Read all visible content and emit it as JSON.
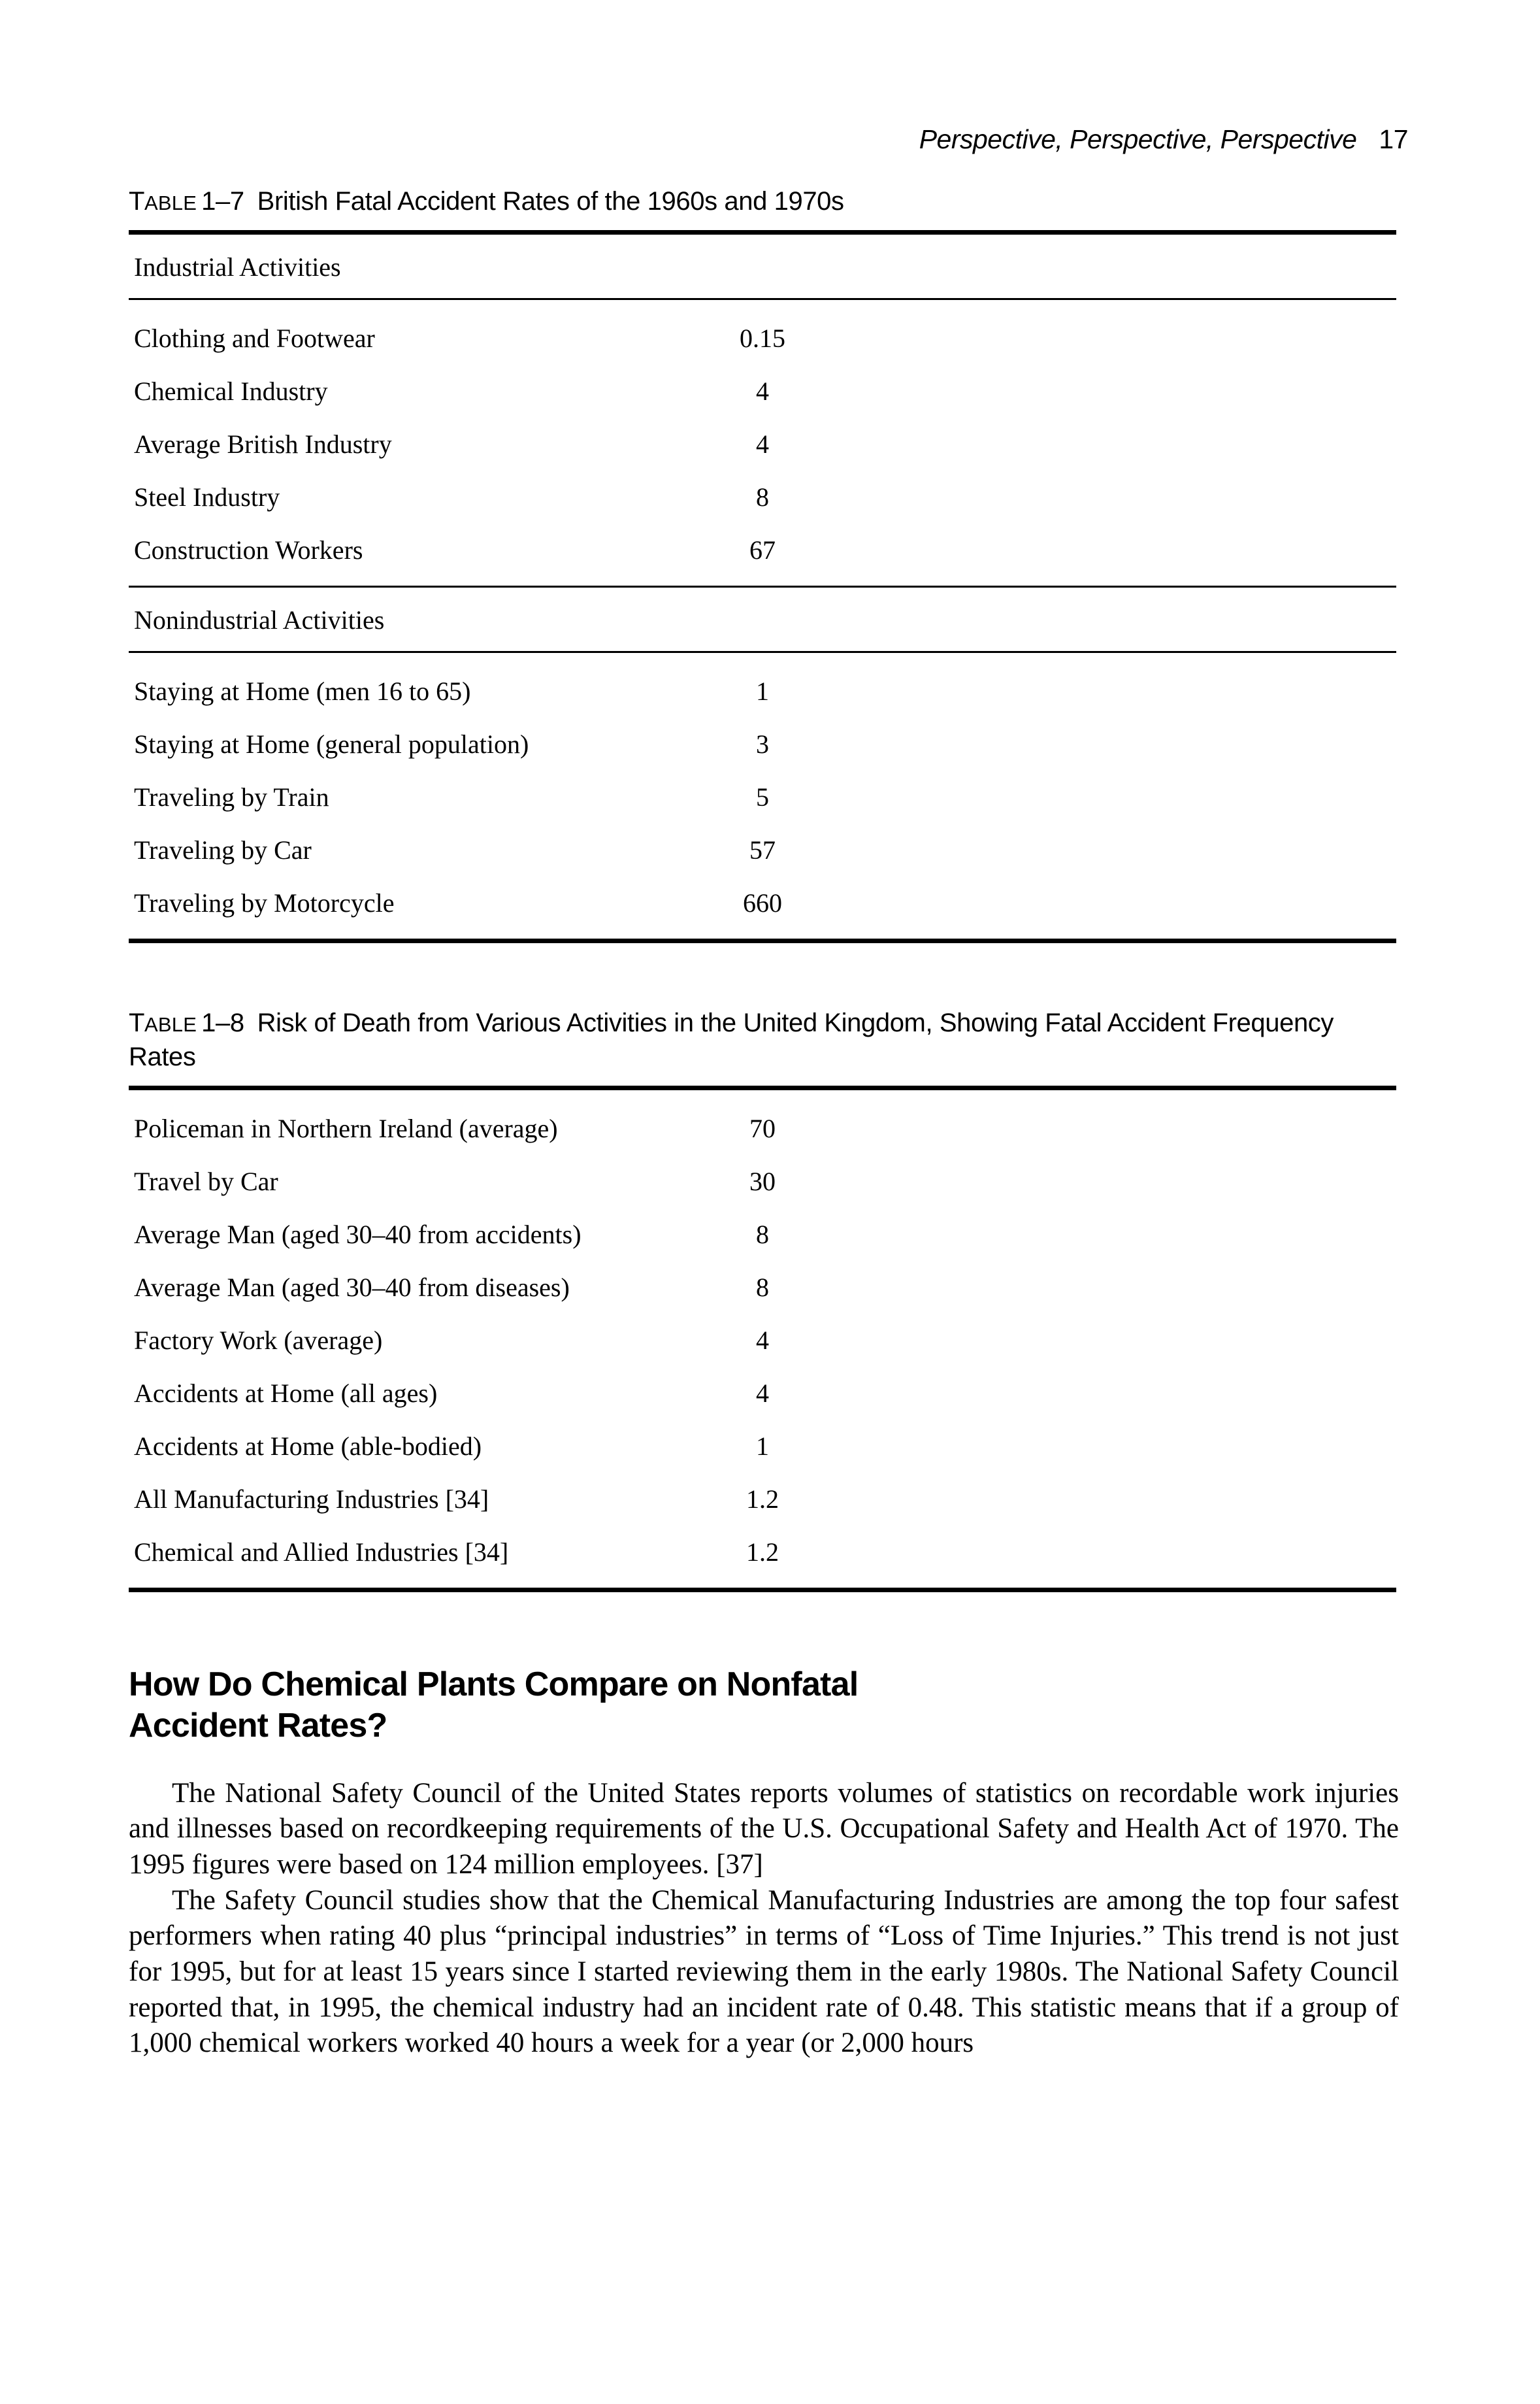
{
  "running_head": {
    "title": "Perspective, Perspective, Perspective",
    "page_number": "17"
  },
  "table_1_7": {
    "caption_label_first": "T",
    "caption_label_rest": "ABLE",
    "caption_number": "1–7",
    "caption_text": "British Fatal Accident Rates of the 1960s and 1970s",
    "sections": [
      {
        "heading": "Industrial Activities",
        "rows": [
          {
            "label": "Clothing and Footwear",
            "value": "0.15"
          },
          {
            "label": "Chemical Industry",
            "value": "4"
          },
          {
            "label": "Average British Industry",
            "value": "4"
          },
          {
            "label": "Steel Industry",
            "value": "8"
          },
          {
            "label": "Construction Workers",
            "value": "67"
          }
        ]
      },
      {
        "heading": "Nonindustrial Activities",
        "rows": [
          {
            "label": "Staying at Home (men 16 to 65)",
            "value": "1"
          },
          {
            "label": "Staying at Home (general population)",
            "value": "3"
          },
          {
            "label": "Traveling by Train",
            "value": "5"
          },
          {
            "label": "Traveling by Car",
            "value": "57"
          },
          {
            "label": "Traveling by Motorcycle",
            "value": "660"
          }
        ]
      }
    ]
  },
  "table_1_8": {
    "caption_label_first": "T",
    "caption_label_rest": "ABLE",
    "caption_number": "1–8",
    "caption_text": "Risk of Death from Various Activities in the United Kingdom, Showing Fatal Accident Frequency Rates",
    "rows": [
      {
        "label": "Policeman in Northern Ireland (average)",
        "value": "70"
      },
      {
        "label": "Travel by Car",
        "value": "30"
      },
      {
        "label": "Average Man (aged 30–40 from accidents)",
        "value": "8"
      },
      {
        "label": "Average Man (aged 30–40 from diseases)",
        "value": "8"
      },
      {
        "label": "Factory Work (average)",
        "value": "4"
      },
      {
        "label": "Accidents at Home (all ages)",
        "value": "4"
      },
      {
        "label": "Accidents at Home (able-bodied)",
        "value": "1"
      },
      {
        "label": "All Manufacturing Industries [34]",
        "value": "1.2"
      },
      {
        "label": "Chemical and Allied Industries [34]",
        "value": "1.2"
      }
    ]
  },
  "section": {
    "heading_line_1": "How Do Chemical Plants Compare on Nonfatal",
    "heading_line_2": "Accident Rates?",
    "paragraph_1": "The National Safety Council of the United States reports volumes of statistics on recordable work injuries and illnesses based on recordkeeping requirements of the U.S. Occupational Safety and Health Act of 1970. The 1995 figures were based on 124 million employees. [37]",
    "paragraph_2": "The Safety Council studies show that the Chemical Manufacturing Industries are among the top four safest performers when rating 40 plus “principal industries” in terms of “Loss of Time Injuries.” This trend is not just for 1995, but for at least 15 years since I started reviewing them in the early 1980s. The National Safety Council reported that, in 1995, the chemical industry had an incident rate of 0.48. This statistic means that if a group of 1,000 chemical workers worked 40 hours a week for a year (or 2,000 hours"
  }
}
